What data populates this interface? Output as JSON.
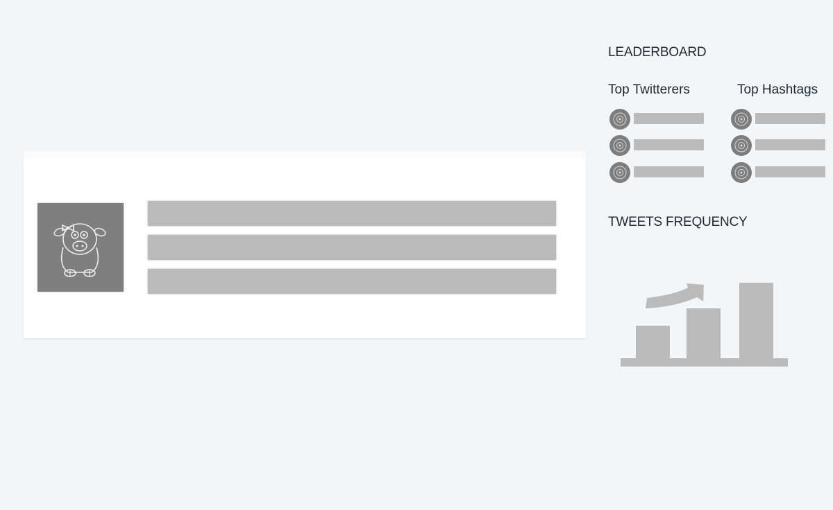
{
  "leaderboard": {
    "title": "LEADERBOARD",
    "top_twitterers": {
      "label": "Top Twitterers",
      "rows": 3
    },
    "top_hashtags": {
      "label": "Top Hashtags",
      "rows": 3
    }
  },
  "tweets_frequency": {
    "title": "TWEETS FREQUENCY",
    "icon": "bar-chart-trend-icon"
  },
  "tweet_card": {
    "avatar_icon": "cow-avatar-icon",
    "placeholder_lines": 3
  },
  "colors": {
    "page_background": "#f3f6f9",
    "card_background": "#ffffff",
    "skeleton_gray": "#bababa",
    "avatar_gray": "#7f7f7f",
    "text": "#1e2a33"
  }
}
